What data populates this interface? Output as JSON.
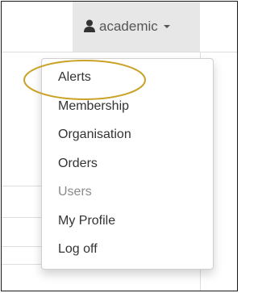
{
  "navbar": {
    "user": {
      "name": "academic",
      "icon": "user-icon"
    }
  },
  "dropdown": {
    "items": [
      {
        "label": "Alerts"
      },
      {
        "label": "Membership"
      },
      {
        "label": "Organisation"
      },
      {
        "label": "Orders"
      },
      {
        "label": "Users",
        "disabled": true
      },
      {
        "label": "My Profile"
      },
      {
        "label": "Log off"
      }
    ]
  },
  "colors": {
    "annotation": "#c9a227",
    "navbar_active_bg": "#e7e7e7",
    "text": "#333333",
    "disabled_text": "#8a8a8a"
  }
}
